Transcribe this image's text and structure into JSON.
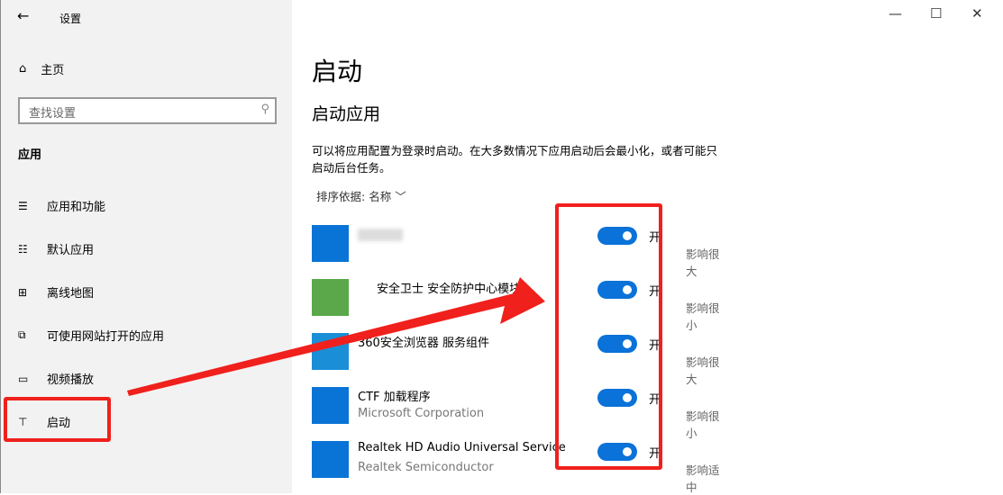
{
  "window": {
    "title": "设置"
  },
  "sidebar": {
    "home": "主页",
    "search_placeholder": "查找设置",
    "section": "应用",
    "items": [
      {
        "label": "应用和功能",
        "icon": "list-icon"
      },
      {
        "label": "默认应用",
        "icon": "default-apps-icon"
      },
      {
        "label": "离线地图",
        "icon": "map-icon"
      },
      {
        "label": "可使用网站打开的应用",
        "icon": "web-app-icon"
      },
      {
        "label": "视频播放",
        "icon": "video-icon"
      },
      {
        "label": "启动",
        "icon": "startup-icon"
      }
    ]
  },
  "main": {
    "title": "启动",
    "subtitle": "启动应用",
    "description": "可以将应用配置为登录时启动。在大多数情况下应用启动后会最小化，或者可能只启动后台任务。",
    "sort_label": "排序依据:",
    "sort_value": "名称",
    "apps": [
      {
        "name": "",
        "publisher": "",
        "state": "开",
        "impact": "影响很大"
      },
      {
        "name": "安全卫士 安全防护中心模块",
        "publisher": "",
        "state": "开",
        "impact": "影响很小"
      },
      {
        "name": "360安全浏览器 服务组件",
        "publisher": "",
        "state": "开",
        "impact": "影响很大"
      },
      {
        "name": "CTF 加载程序",
        "publisher": "Microsoft Corporation",
        "state": "开",
        "impact": "影响很小"
      },
      {
        "name": "Realtek HD Audio Universal Service",
        "publisher": "Realtek Semiconductor",
        "state": "开",
        "impact": "影响适中"
      }
    ]
  },
  "colors": {
    "accent": "#0a72d8",
    "annotation": "#f0201c"
  }
}
